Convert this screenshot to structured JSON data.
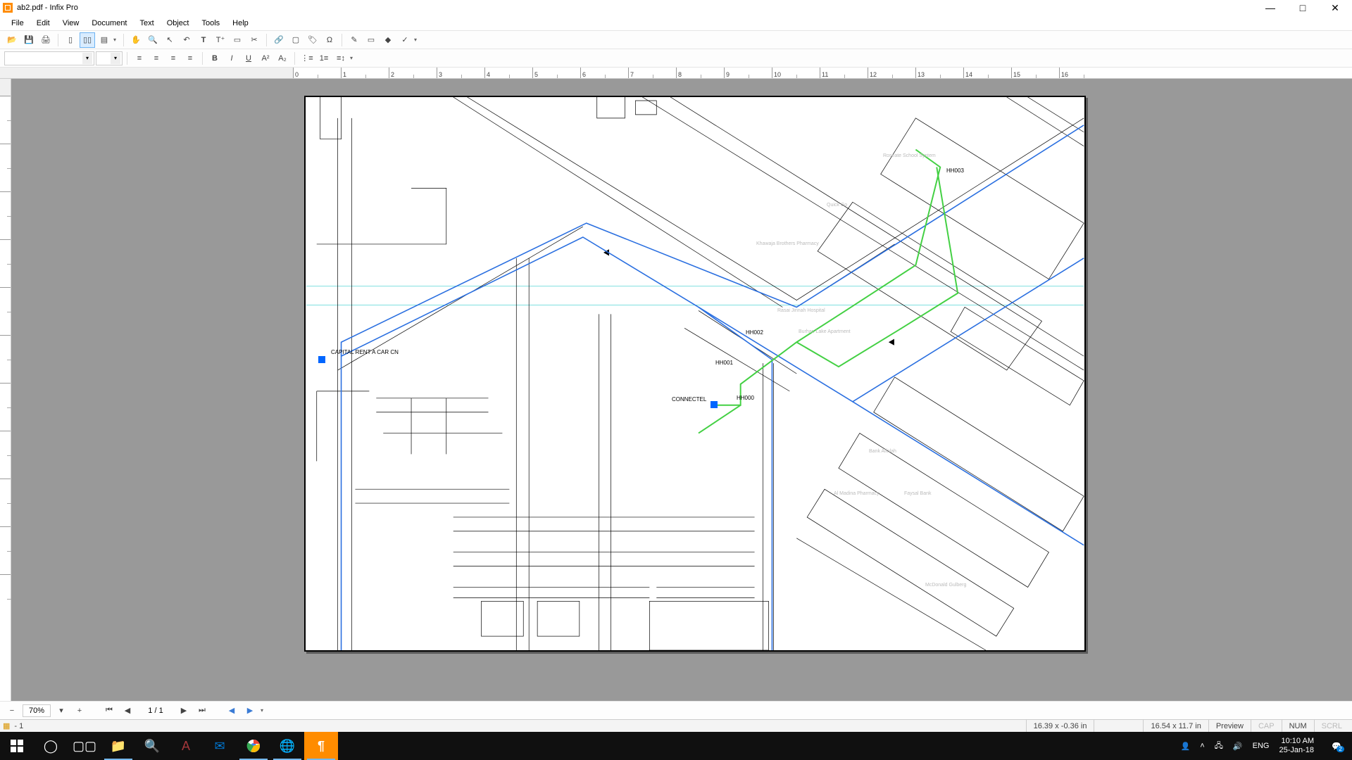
{
  "window": {
    "title": "ab2.pdf - Infix Pro",
    "min": "—",
    "max": "□",
    "close": "✕"
  },
  "menu": {
    "file": "File",
    "edit": "Edit",
    "view": "View",
    "document": "Document",
    "text": "Text",
    "object": "Object",
    "tools": "Tools",
    "help": "Help"
  },
  "nav": {
    "zoom": "70%",
    "page": "1 / 1"
  },
  "status": {
    "left_icon": "▦",
    "left_text": "- 1",
    "coords": "16.39 x -0.36 in",
    "pagesize": "16.54 x 11.7 in",
    "mode": "Preview",
    "cap": "CAP",
    "num": "NUM",
    "scrl": "SCRL"
  },
  "map": {
    "label_capital": "CAPITAL RENT A CAR CN",
    "label_connectel": "CONNECTEL",
    "hh000": "HH000",
    "hh001": "HH001",
    "hh002": "HH002",
    "hh003": "HH003",
    "faint1": "Roseate School System",
    "faint2": "Quick Go",
    "faint3": "Khawaja Brothers Pharmacy",
    "faint4": "Rasai Jinnah Hospital",
    "faint5": "Burhan Lake Apartment",
    "faint6": "Bank Alfalah",
    "faint7": "Al Madina Pharmacy",
    "faint8": "Faysal Bank",
    "faint9": "McDonald Gulberg"
  },
  "tray": {
    "lang": "ENG",
    "time": "10:10 AM",
    "date": "25-Jan-18",
    "notif_count": "2"
  },
  "ruler": {
    "n0": "0",
    "n1": "1",
    "n2": "2",
    "n3": "3",
    "n4": "4",
    "n5": "5",
    "n6": "6",
    "n7": "7",
    "n8": "8",
    "n9": "9",
    "n10": "10",
    "n11": "11",
    "n12": "12",
    "n13": "13",
    "n14": "14",
    "n15": "15",
    "n16": "16"
  }
}
